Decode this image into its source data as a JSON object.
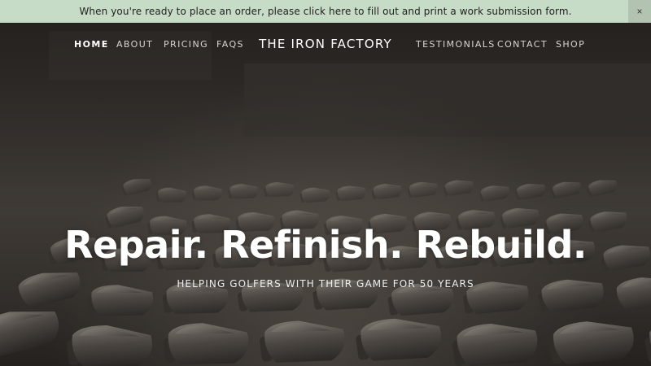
{
  "announcement": {
    "text": "When you're ready to place an order, please click here to fill out and print a work submission form.",
    "close_label": "×"
  },
  "nav": {
    "left": [
      {
        "label": "HOME",
        "active": true
      },
      {
        "label": "ABOUT",
        "active": false
      },
      {
        "label": "PRICING",
        "active": false
      },
      {
        "label": "FAQS",
        "active": false
      }
    ],
    "brand": "THE IRON FACTORY",
    "right": [
      {
        "label": "TESTIMONIALS",
        "active": false
      },
      {
        "label": "CONTACT",
        "active": false
      },
      {
        "label": "SHOP",
        "active": false
      }
    ]
  },
  "hero": {
    "headline": "Repair. Refinish. Rebuild.",
    "subheadline": "HELPING GOLFERS WITH THEIR GAME FOR 50 YEARS",
    "background_image": "golf-iron-heads-photo"
  },
  "colors": {
    "announcement_bg": "#c7dcc6",
    "hero_text": "#ffffff"
  }
}
